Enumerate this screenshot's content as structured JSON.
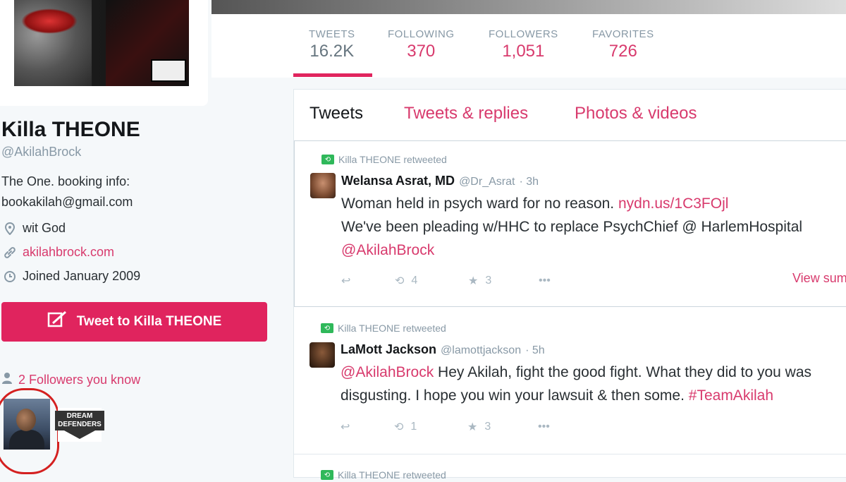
{
  "profile": {
    "name": "Killa THEONE",
    "handle": "@AkilahBrock",
    "bio_line1": "The One. booking info:",
    "bio_line2": "bookakilah@gmail.com",
    "location": "wit God",
    "website": "akilahbrock.com",
    "joined": "Joined January 2009",
    "tweet_to_label": "Tweet to Killa THEONE",
    "followers_you_know": "2 Followers you know",
    "follower2_badge": "DREAM DEFENDERS"
  },
  "stats": [
    {
      "label": "TWEETS",
      "value": "16.2K"
    },
    {
      "label": "FOLLOWING",
      "value": "370"
    },
    {
      "label": "FOLLOWERS",
      "value": "1,051"
    },
    {
      "label": "FAVORITES",
      "value": "726"
    }
  ],
  "tabs": [
    "Tweets",
    "Tweets & replies",
    "Photos & videos"
  ],
  "tweets": [
    {
      "retweet_note": "Killa THEONE retweeted",
      "name": "Welansa Asrat, MD",
      "handle": "@Dr_Asrat",
      "time": "· 3h",
      "line1_text": "Woman held in psych ward for no reason.",
      "line1_link": "nydn.us/1C3FOjl",
      "line2_text": "We've been pleading w/HHC to replace PsychChief @ HarlemHospital",
      "line3_link": "@AkilahBrock",
      "retweets": "4",
      "favorites": "3",
      "view_summary": "View summary"
    },
    {
      "retweet_note": "Killa THEONE retweeted",
      "name": "LaMott Jackson",
      "handle": "@lamottjackson",
      "time": "· 5h",
      "line1_link": "@AkilahBrock",
      "line1_text": "Hey Akilah, fight the good fight. What they did to you was",
      "line2_text": "disgusting. I hope you win your lawsuit & then some.",
      "line2_link": "#TeamAkilah",
      "retweets": "1",
      "favorites": "3"
    },
    {
      "retweet_note": "Killa THEONE retweeted"
    }
  ],
  "icons": {
    "reply": "↩",
    "retweet": "⟲",
    "favorite": "★",
    "more": "•••"
  }
}
